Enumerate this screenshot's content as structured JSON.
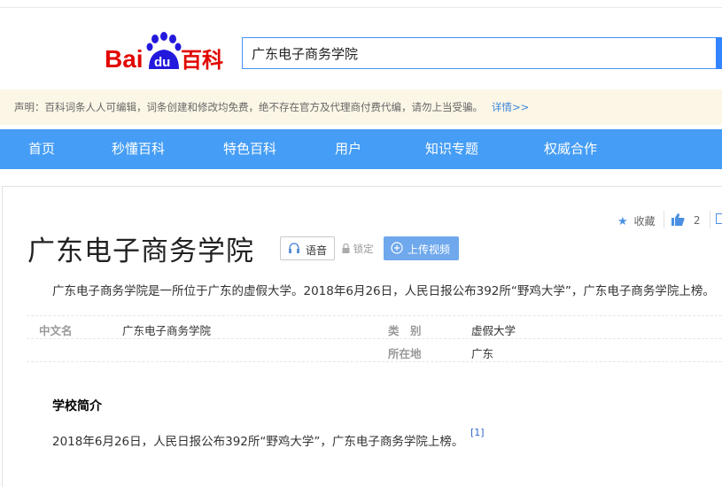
{
  "header": {
    "logo_text": "Bai百科",
    "logo_badge": "du",
    "search_value": "广东电子商务学院"
  },
  "notice": {
    "text": "声明：百科词条人人可编辑，词条创建和修改均免费，绝不存在官方及代理商付费代编，请勿上当受骗。",
    "more": "详情>>"
  },
  "nav": [
    "首页",
    "秒懂百科",
    "特色百科",
    "用户",
    "知识专题",
    "权威合作"
  ],
  "toolbar": {
    "favorite": "收藏",
    "like_count": "2"
  },
  "lemma": {
    "title": "广东电子商务学院",
    "voice": "语音",
    "lock": "锁定",
    "upload": "上传视频",
    "summary": "广东电子商务学院是一所位于广东的虚假大学。2018年6月26日，人民日报公布392所“野鸡大学”，广东电子商务学院上榜。"
  },
  "basic_info": {
    "left": [
      {
        "label": "中文名",
        "value": "广东电子商务学院"
      }
    ],
    "right": [
      {
        "label": "类　别",
        "value": "虚假大学"
      },
      {
        "label": "所在地",
        "value": "广东"
      }
    ]
  },
  "section": {
    "title": "学校简介",
    "paragraph": "2018年6月26日，人民日报公布392所“野鸡大学”，广东电子商务学院上榜。",
    "ref": "[1]"
  },
  "colors": {
    "nav_bg": "#459df5",
    "logo_red": "#e10601",
    "logo_blue": "#2319dc",
    "notice_bg": "#fcf6e6",
    "link": "#3b87dc"
  }
}
